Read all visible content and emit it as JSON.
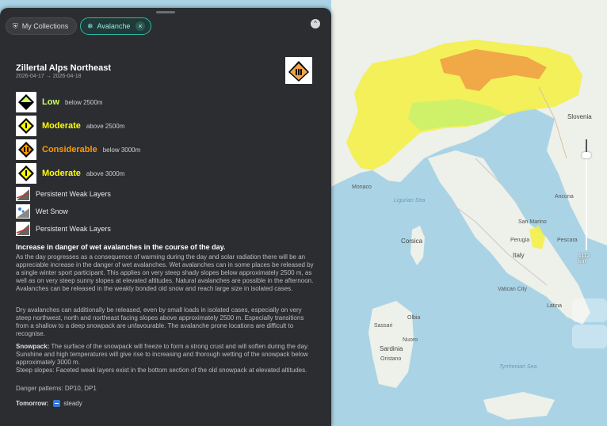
{
  "toolbar": {
    "collections_label": "My Collections",
    "avalanche_label": "Avalanche",
    "close_glyph": "×",
    "collapse_glyph": "^"
  },
  "region": {
    "title": "Zillertal Alps Northeast",
    "dates": "2026-04-17 → 2026-04-18"
  },
  "danger_levels": [
    {
      "label": "Low",
      "elevation": "below 2500m",
      "color": "#ccff66",
      "level": 1
    },
    {
      "label": "Moderate",
      "elevation": "above 2500m",
      "color": "#ffff00",
      "level": 2
    },
    {
      "label": "Considerable",
      "elevation": "below 3000m",
      "color": "#ff9900",
      "level": 3
    },
    {
      "label": "Moderate",
      "elevation": "above 3000m",
      "color": "#ffff00",
      "level": 2
    }
  ],
  "problems": [
    {
      "label": "Persistent Weak Layers",
      "icon": "persistent-weak-layers-icon"
    },
    {
      "label": "Wet Snow",
      "icon": "wet-snow-icon"
    },
    {
      "label": "Persistent Weak Layers",
      "icon": "persistent-weak-layers-icon"
    }
  ],
  "report": {
    "headline": "Increase in danger of wet avalanches in the course of the day.",
    "para1": "As the day progresses as a consequence of warming during the day and solar radiation there will be an appreciable increase in the danger of wet avalanches. Wet avalanches can in some places be released by a single winter sport participant. This applies on very steep shady slopes below approximately 2500 m, as well as on very steep sunny slopes at elevated altitudes. Natural avalanches are possible in the afternoon. Avalanches can be released in the weakly bonded old snow and reach large size in isolated cases.",
    "para2": "Dry avalanches can additionally be released, even by small loads in isolated cases, especially on very steep northwest, north and northeast facing slopes above approximately 2500 m. Especially transitions from a shallow to a deep snowpack are unfavourable. The avalanche prone locations are difficult to recognise.",
    "snowpack_label": "Snowpack:",
    "snowpack_text": "The surface of the snowpack will freeze to form a strong crust and will soften during the day. Sunshine and high temperatures will give rise to increasing and thorough wetting of the snowpack below approximately 3000 m.",
    "steep_slopes": "Steep slopes: Faceted weak layers exist in the bottom section of the old snowpack at elevated altitudes.",
    "danger_patterns": "Danger patterns: DP10, DP1",
    "tomorrow_label": "Tomorrow:",
    "tomorrow_value": "steady"
  },
  "map": {
    "labels": {
      "slovenia": "Slovenia",
      "monaco": "Monaco",
      "ligurian_sea": "Ligurian Sea",
      "corsica": "Corsica",
      "sardinia": "Sardinia",
      "italy": "Italy",
      "vatican_city": "Vatican City",
      "san_marino": "San Marino",
      "tyrrhenian_sea": "Tyrrhenian Sea",
      "sassari": "Sassari",
      "olbia": "Olbia",
      "nuoro": "Nuoro",
      "oristano": "Oristano",
      "ancona": "Ancona",
      "pescara": "Pescara",
      "perugia": "Perugia",
      "latina": "Latina"
    },
    "zoom_scale": "1112 km",
    "danger_colors": {
      "low": "#ccf06a",
      "moderate": "#f3ef4a",
      "considerable": "#f0a347"
    }
  }
}
